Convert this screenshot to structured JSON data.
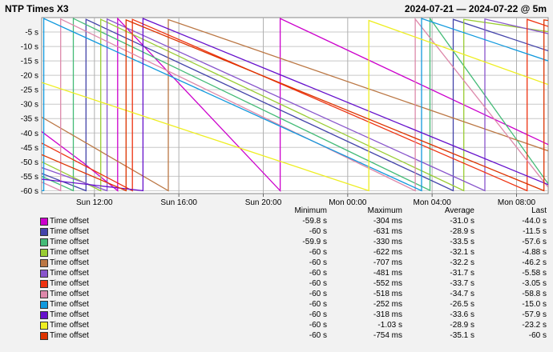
{
  "header": {
    "title": "NTP Times X3",
    "range": "2024-07-21 — 2024-07-22 @ 5m"
  },
  "legend_headers": {
    "minimum": "Minimum",
    "maximum": "Maximum",
    "average": "Average",
    "last": "Last"
  },
  "chart_data": {
    "type": "line",
    "title": "",
    "xlabel": "",
    "ylabel": "",
    "ylim": [
      -61,
      0
    ],
    "yticks": [
      -5,
      -10,
      -15,
      -20,
      -25,
      -30,
      -35,
      -40,
      -45,
      -50,
      -55,
      -60
    ],
    "ytick_labels": [
      "-5 s",
      "-10 s",
      "-15 s",
      "-20 s",
      "-25 s",
      "-30 s",
      "-35 s",
      "-40 s",
      "-45 s",
      "-50 s",
      "-55 s",
      "-60 s"
    ],
    "xlim_hours": [
      9.5,
      33.5
    ],
    "xticks": [
      12,
      16,
      20,
      24,
      28,
      32
    ],
    "xtick_labels": [
      "Sun 12:00",
      "Sun 16:00",
      "Sun 20:00",
      "Mon 00:00",
      "Mon 04:00",
      "Mon 08:00"
    ],
    "grid": true,
    "series": [
      {
        "name": "Time offset",
        "color": "#cc00cc",
        "min": "-59.8 s",
        "max": "-304 ms",
        "avg": "-31.0 s",
        "last": "-44.0 s",
        "points": [
          [
            9.5,
            -39.5
          ],
          [
            11.5,
            -50.5
          ],
          [
            13.1,
            -60.0
          ],
          [
            13.1,
            -0.3
          ],
          [
            20.8,
            -60.0
          ],
          [
            20.8,
            -0.3
          ],
          [
            33.5,
            -44.0
          ]
        ]
      },
      {
        "name": "Time offset",
        "color": "#4444aa",
        "min": "-60 s",
        "max": "-631 ms",
        "avg": "-28.9 s",
        "last": "-11.5 s",
        "points": [
          [
            9.5,
            -54.0
          ],
          [
            11.6,
            -60.0
          ],
          [
            11.6,
            -0.6
          ],
          [
            29.0,
            -60.0
          ],
          [
            29.0,
            -0.6
          ],
          [
            33.5,
            -11.5
          ]
        ]
      },
      {
        "name": "Time offset",
        "color": "#44bb77",
        "min": "-59.9 s",
        "max": "-330 ms",
        "avg": "-33.5 s",
        "last": "-57.6 s",
        "points": [
          [
            9.5,
            -55.0
          ],
          [
            11.0,
            -60.0
          ],
          [
            11.0,
            -0.3
          ],
          [
            27.9,
            -59.9
          ],
          [
            27.9,
            -0.3
          ],
          [
            33.5,
            -57.6
          ]
        ]
      },
      {
        "name": "Time offset",
        "color": "#99cc33",
        "min": "-60 s",
        "max": "-622 ms",
        "avg": "-32.1 s",
        "last": "-4.88 s",
        "points": [
          [
            9.5,
            -50.0
          ],
          [
            12.3,
            -60.0
          ],
          [
            12.3,
            -0.6
          ],
          [
            29.5,
            -60.0
          ],
          [
            29.5,
            -0.6
          ],
          [
            33.5,
            -4.88
          ]
        ]
      },
      {
        "name": "Time offset",
        "color": "#bb7744",
        "min": "-60 s",
        "max": "-707 ms",
        "avg": "-32.2 s",
        "last": "-46.2 s",
        "points": [
          [
            9.5,
            -34.5
          ],
          [
            15.5,
            -60.0
          ],
          [
            15.5,
            -0.7
          ],
          [
            33.5,
            -46.2
          ]
        ]
      },
      {
        "name": "Time offset",
        "color": "#8855cc",
        "min": "-60 s",
        "max": "-481 ms",
        "avg": "-31.7 s",
        "last": "-5.58 s",
        "points": [
          [
            9.5,
            -52.0
          ],
          [
            12.6,
            -60.0
          ],
          [
            12.6,
            -0.5
          ],
          [
            30.5,
            -60.0
          ],
          [
            30.5,
            -0.5
          ],
          [
            33.5,
            -5.58
          ]
        ]
      },
      {
        "name": "Time offset",
        "color": "#ee3311",
        "min": "-60 s",
        "max": "-552 ms",
        "avg": "-33.7 s",
        "last": "-3.05 s",
        "points": [
          [
            9.5,
            -43.5
          ],
          [
            13.8,
            -60.0
          ],
          [
            13.8,
            -0.6
          ],
          [
            32.5,
            -60.0
          ],
          [
            32.5,
            -0.6
          ],
          [
            33.5,
            -3.05
          ]
        ]
      },
      {
        "name": "Time offset",
        "color": "#dd88aa",
        "min": "-60 s",
        "max": "-518 ms",
        "avg": "-34.7 s",
        "last": "-58.8 s",
        "points": [
          [
            9.5,
            -57.0
          ],
          [
            10.4,
            -60.0
          ],
          [
            10.4,
            -0.5
          ],
          [
            27.2,
            -60.0
          ],
          [
            27.2,
            -0.5
          ],
          [
            33.5,
            -58.8
          ]
        ]
      },
      {
        "name": "Time offset",
        "color": "#1199dd",
        "min": "-60 s",
        "max": "-252 ms",
        "avg": "-26.5 s",
        "last": "-15.0 s",
        "points": [
          [
            9.5,
            -60.0
          ],
          [
            9.6,
            -60.0
          ],
          [
            9.6,
            -0.3
          ],
          [
            27.5,
            -60.0
          ],
          [
            27.5,
            -0.3
          ],
          [
            33.5,
            -15.0
          ]
        ]
      },
      {
        "name": "Time offset",
        "color": "#6611cc",
        "min": "-60 s",
        "max": "-318 ms",
        "avg": "-33.6 s",
        "last": "-57.9 s",
        "points": [
          [
            9.5,
            -56.0
          ],
          [
            14.3,
            -60.0
          ],
          [
            14.3,
            -0.3
          ],
          [
            33.5,
            -57.9
          ]
        ]
      },
      {
        "name": "Time offset",
        "color": "#eeee22",
        "min": "-60 s",
        "max": "-1.03 s",
        "avg": "-28.9 s",
        "last": "-23.2 s",
        "points": [
          [
            9.5,
            -22.5
          ],
          [
            25.0,
            -60.0
          ],
          [
            25.0,
            -1.0
          ],
          [
            33.5,
            -23.2
          ]
        ]
      },
      {
        "name": "Time offset",
        "color": "#dd3300",
        "min": "-60 s",
        "max": "-754 ms",
        "avg": "-35.1 s",
        "last": "-60 s",
        "points": [
          [
            9.5,
            -47.5
          ],
          [
            13.5,
            -60.0
          ],
          [
            13.5,
            -0.8
          ],
          [
            33.3,
            -60.0
          ],
          [
            33.3,
            -0.8
          ],
          [
            33.5,
            -1.0
          ]
        ]
      }
    ]
  }
}
